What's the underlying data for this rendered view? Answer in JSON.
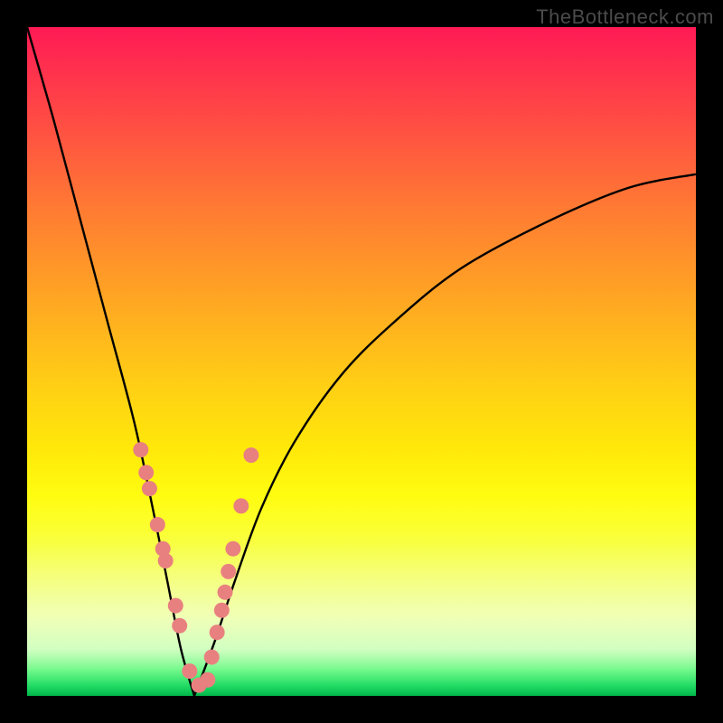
{
  "watermark": "TheBottleneck.com",
  "colors": {
    "curve": "#000000",
    "dot_fill": "#e98080",
    "dot_stroke": "#d46a6a",
    "gradient_top": "#ff1a55",
    "gradient_bottom": "#00b74a"
  },
  "chart_data": {
    "type": "line",
    "title": "",
    "xlabel": "",
    "ylabel": "",
    "xlim": [
      0,
      100
    ],
    "ylim": [
      0,
      100
    ],
    "grid": false,
    "note": "V-shaped bottleneck curve with vertex near x≈25, y≈0; left leg rises steeply toward 100 at x≈0, right leg rises and asymptotes toward ~78 at x=100. Data points cluster on both legs below y≈40.",
    "series": [
      {
        "name": "left_leg",
        "x": [
          0,
          4,
          8,
          12,
          16,
          19,
          21,
          23,
          25
        ],
        "y": [
          100,
          86,
          71,
          56,
          41,
          27,
          17,
          7,
          0
        ]
      },
      {
        "name": "right_leg",
        "x": [
          25,
          28,
          31,
          35,
          40,
          47,
          55,
          65,
          78,
          90,
          100
        ],
        "y": [
          0,
          8,
          17,
          28,
          38,
          48,
          56,
          64,
          71,
          76,
          78
        ]
      },
      {
        "name": "data_points",
        "type": "scatter",
        "x": [
          17.0,
          17.8,
          18.3,
          19.5,
          20.3,
          20.7,
          22.2,
          22.8,
          24.3,
          25.7,
          27.0,
          27.6,
          28.4,
          29.1,
          29.6,
          30.1,
          30.8,
          32.0,
          33.5
        ],
        "y": [
          36.8,
          33.4,
          31.0,
          25.6,
          22.0,
          20.2,
          13.5,
          10.5,
          3.7,
          1.6,
          2.4,
          5.8,
          9.5,
          12.8,
          15.5,
          18.6,
          22.0,
          28.4,
          36.0
        ]
      }
    ]
  }
}
